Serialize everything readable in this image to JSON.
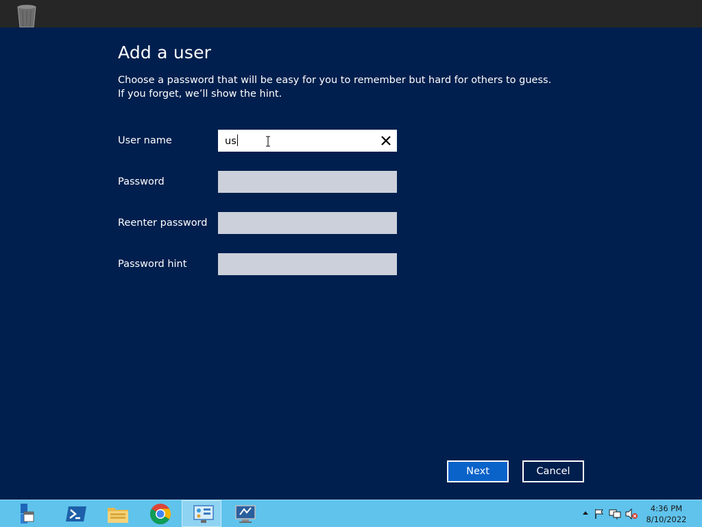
{
  "dialog": {
    "title": "Add a user",
    "description": "Choose a password that will be easy for you to remember but hard for others to guess. If you forget, we’ll show the hint.",
    "fields": {
      "username": {
        "label": "User name",
        "value": "us"
      },
      "password": {
        "label": "Password",
        "value": ""
      },
      "reenter_password": {
        "label": "Reenter password",
        "value": ""
      },
      "password_hint": {
        "label": "Password hint",
        "value": ""
      }
    },
    "buttons": {
      "next": "Next",
      "cancel": "Cancel"
    }
  },
  "desktop": {
    "icons": [
      "recycle-bin-icon"
    ]
  },
  "taskbar": {
    "items": [
      {
        "icon": "server-manager-icon",
        "active": false
      },
      {
        "icon": "powershell-icon",
        "active": false
      },
      {
        "icon": "file-explorer-icon",
        "active": false
      },
      {
        "icon": "chrome-icon",
        "active": false
      },
      {
        "icon": "control-panel-icon",
        "active": true
      },
      {
        "icon": "remote-desktop-icon",
        "active": false
      }
    ],
    "tray": {
      "icons": [
        "show-hidden-icons-arrow",
        "action-center-flag-icon",
        "network-icon",
        "volume-muted-icon"
      ],
      "time": "4:36 PM",
      "date": "8/10/2022"
    }
  },
  "colors": {
    "panel_background": "#001f4e",
    "next_button": "#0a63c9",
    "empty_field": "#ccd0da",
    "taskbar": "#5fc3ec"
  }
}
